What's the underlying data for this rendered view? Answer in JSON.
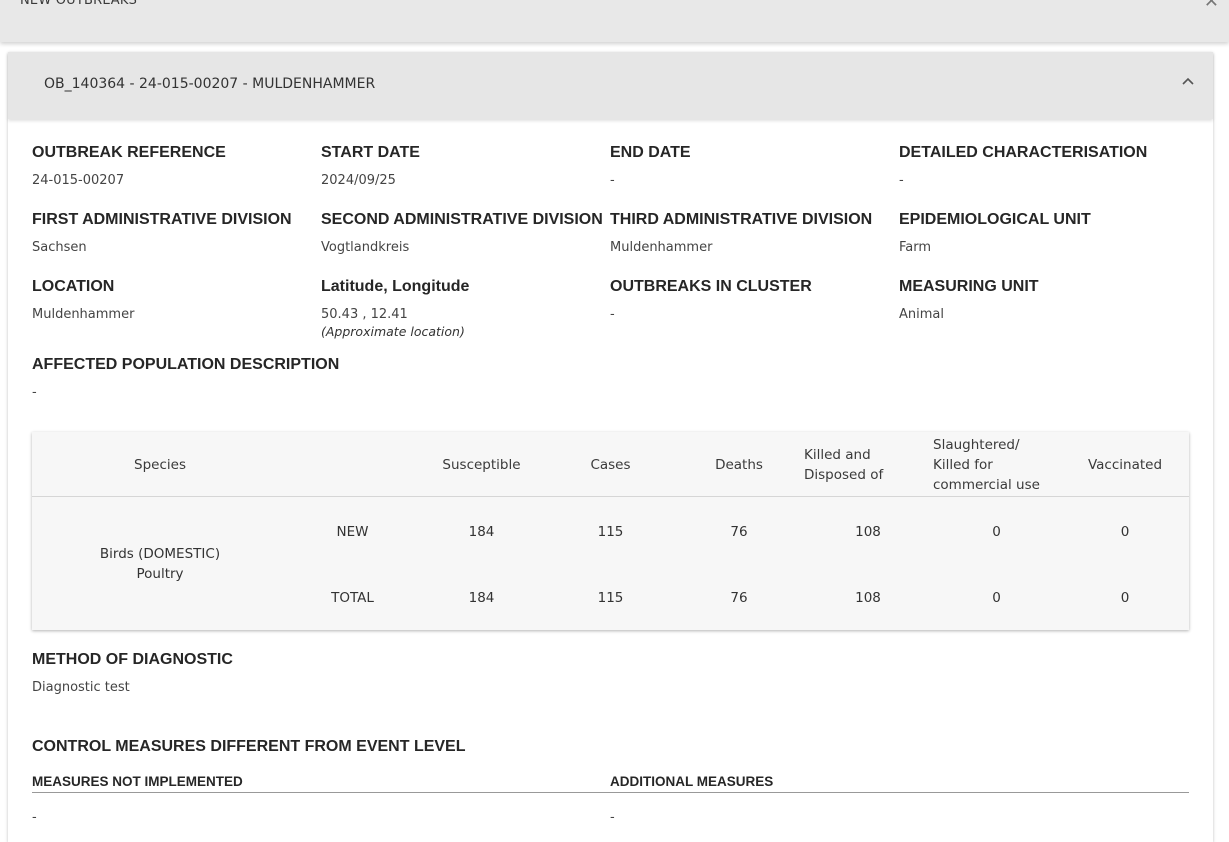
{
  "topbar": {
    "title": "NEW OUTBREAKS",
    "close_glyph": "✕"
  },
  "panel": {
    "title": "OB_140364 - 24-015-00207 - MULDENHAMMER"
  },
  "fields": {
    "outbreak_reference": {
      "label": "OUTBREAK REFERENCE",
      "value": "24-015-00207"
    },
    "start_date": {
      "label": "START DATE",
      "value": "2024/09/25"
    },
    "end_date": {
      "label": "END DATE",
      "value": "-"
    },
    "detailed_characterisation": {
      "label": "DETAILED CHARACTERISATION",
      "value": "-"
    },
    "first_admin": {
      "label": "FIRST ADMINISTRATIVE DIVISION",
      "value": "Sachsen"
    },
    "second_admin": {
      "label": "SECOND ADMINISTRATIVE DIVISION",
      "value": "Vogtlandkreis"
    },
    "third_admin": {
      "label": "THIRD ADMINISTRATIVE DIVISION",
      "value": "Muldenhammer"
    },
    "epi_unit": {
      "label": "EPIDEMIOLOGICAL UNIT",
      "value": "Farm"
    },
    "location": {
      "label": "LOCATION",
      "value": "Muldenhammer"
    },
    "latlon": {
      "label": "Latitude, Longitude",
      "value": "50.43 , 12.41",
      "note": "(Approximate location)"
    },
    "outbreaks_in_cluster": {
      "label": "OUTBREAKS IN CLUSTER",
      "value": "-"
    },
    "measuring_unit": {
      "label": "MEASURING UNIT",
      "value": "Animal"
    },
    "affected_population": {
      "label": "AFFECTED POPULATION DESCRIPTION",
      "value": "-"
    }
  },
  "table": {
    "headers": {
      "species": "Species",
      "susceptible": "Susceptible",
      "cases": "Cases",
      "deaths": "Deaths",
      "killed_1": "Killed and",
      "killed_2": "Disposed of",
      "slaughtered_1": "Slaughtered/",
      "slaughtered_2": "Killed for",
      "slaughtered_3": "commercial use",
      "vaccinated": "Vaccinated"
    },
    "species_line1": "Birds (DOMESTIC)",
    "species_line2": "Poultry",
    "rows": [
      {
        "type": "NEW",
        "susceptible": "184",
        "cases": "115",
        "deaths": "76",
        "killed": "108",
        "slaughtered": "0",
        "vaccinated": "0"
      },
      {
        "type": "TOTAL",
        "susceptible": "184",
        "cases": "115",
        "deaths": "76",
        "killed": "108",
        "slaughtered": "0",
        "vaccinated": "0"
      }
    ]
  },
  "diagnostic": {
    "label": "METHOD OF DIAGNOSTIC",
    "value": "Diagnostic test"
  },
  "control": {
    "label": "CONTROL MEASURES DIFFERENT FROM EVENT LEVEL",
    "not_implemented_label": "MEASURES NOT IMPLEMENTED",
    "not_implemented_value": "-",
    "additional_label": "ADDITIONAL MEASURES",
    "additional_value": "-"
  }
}
